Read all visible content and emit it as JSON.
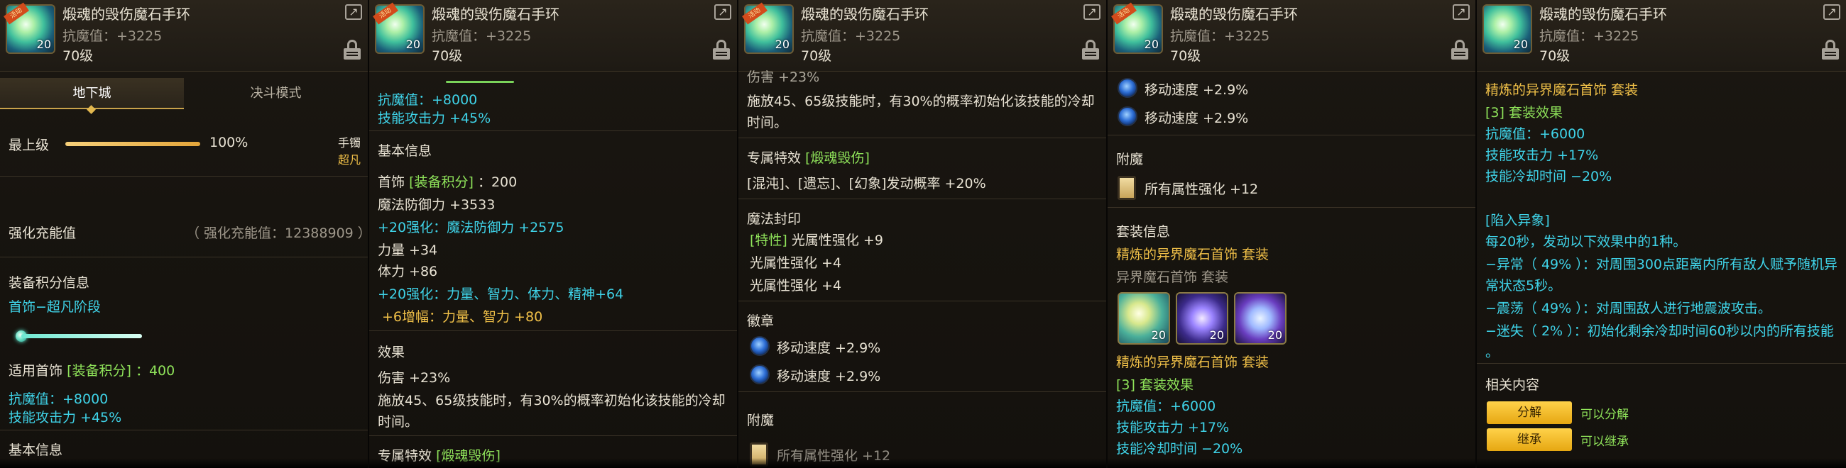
{
  "item": {
    "name": "煅魂的毁伤魔石手环",
    "stat": "抗魔值：+3225",
    "level": "70级",
    "icon_level": "20",
    "ribbon": "活动"
  },
  "panel1": {
    "tabs": [
      "地下城",
      "决斗模式"
    ],
    "top_level_label": "最上级",
    "top_level_pct": "100%",
    "top_level_fraction": 1.0,
    "slot_type": "手镯",
    "slot_grade": "超凡",
    "reinforce_label": "强化充能值",
    "reinforce_value": "（ 强化充能值：12388909 ）",
    "score_title": "装备积分信息",
    "score_stage": "首饰−超凡阶段",
    "apply_prefix": "适用首饰",
    "apply_tag": "[装备积分]",
    "apply_value": "：400",
    "anti_magic": "抗魔值：+8000",
    "skill_atk": "技能攻击力 +45%",
    "basic_info": "基本信息"
  },
  "panel2": {
    "anti_magic": "抗魔值：+8000",
    "skill_atk": "技能攻击力 +45%",
    "basic_info": "基本信息",
    "acc_prefix": "首饰",
    "acc_tag": "[装备积分]",
    "acc_value": "：200",
    "mdef": "魔法防御力 +3533",
    "reinforce_mdef_a": "+20强化：",
    "reinforce_mdef_b": "魔法防御力 +2575",
    "str": "力量 +34",
    "vit": "体力 +86",
    "reinforce_all_a": "+20强化：",
    "reinforce_all_b": "力量、智力、体力、精神+64",
    "amplify_a": "+6增幅：",
    "amplify_b": "力量、智力 +80",
    "effect_title": "效果",
    "damage": "伤害 +23%",
    "desc1": "施放45、65级技能时，有30%的概率初始化该技能的冷却",
    "desc2": "时间。",
    "exclusive_prefix": "专属特效",
    "exclusive_tag": "[煅魂毁伤]"
  },
  "panel3": {
    "damage_partial": "伤害 +23%",
    "desc1": "施放45、65级技能时，有30%的概率初始化该技能的冷却",
    "desc2": "时间。",
    "exclusive_prefix": "专属特效",
    "exclusive_tag": "[煅魂毁伤]",
    "status_line": "[混沌]、[遗忘]、[幻象]发动概率 +20%",
    "seal_title": "魔法封印",
    "seal_tag": "[特性]",
    "seal1": "光属性强化 +9",
    "seal2": "光属性强化 +4",
    "seal3": "光属性强化 +4",
    "emblem_title": "徽章",
    "emblem1": "移动速度 +2.9%",
    "emblem2": "移动速度 +2.9%",
    "enchant_title": "附魔",
    "enchant_partial": "所有属性强化 +12"
  },
  "panel4": {
    "emblem1": "移动速度 +2.9%",
    "emblem2": "移动速度 +2.9%",
    "enchant_title": "附魔",
    "enchant_line": "所有属性强化 +12",
    "set_title": "套装信息",
    "set_name": "精炼的异界魔石首饰  套装",
    "set_sub": "异界魔石首饰  套装",
    "set_icon_level": "20",
    "set_name2": "精炼的异界魔石首饰  套装",
    "set_bonus": "[3] 套装效果",
    "set_anti": "抗魔值：+6000",
    "set_atk": "技能攻击力 +17%",
    "set_cd": "技能冷却时间 −20%"
  },
  "panel5": {
    "set_name": "精炼的异界魔石首饰  套装",
    "set_bonus": "[3] 套装效果",
    "set_anti": "抗魔值：+6000",
    "set_atk": "技能攻击力 +17%",
    "set_cd": "技能冷却时间 −20%",
    "trap_title": "[陷入异象]",
    "trap_line1": "每20秒，发动以下效果中的1种。",
    "trap_line2": "−异常（ 49% ）：对周围300点距离内所有敌人赋予随机异",
    "trap_line3": "常状态5秒。",
    "trap_line4": "−震荡（ 49% ）：对周围敌人进行地震波攻击。",
    "trap_line5": "−迷失（ 2% ）：初始化剩余冷却时间60秒以内的所有技能",
    "trap_line6": "。",
    "related_title": "相关内容",
    "btn_decompose": "分解",
    "decompose_note": "可以分解",
    "btn_inherit": "继承",
    "inherit_note": "可以继承"
  },
  "colors": {
    "cyan": "#3fd3e8",
    "gold": "#f0c048",
    "green": "#8fe35a",
    "button": "#f2bc2a"
  },
  "icons": {
    "share": "share-icon",
    "lock": "lock-icon",
    "emblem": "blue-orb-icon",
    "enchant": "card-icon",
    "gem": "gem-icon"
  }
}
